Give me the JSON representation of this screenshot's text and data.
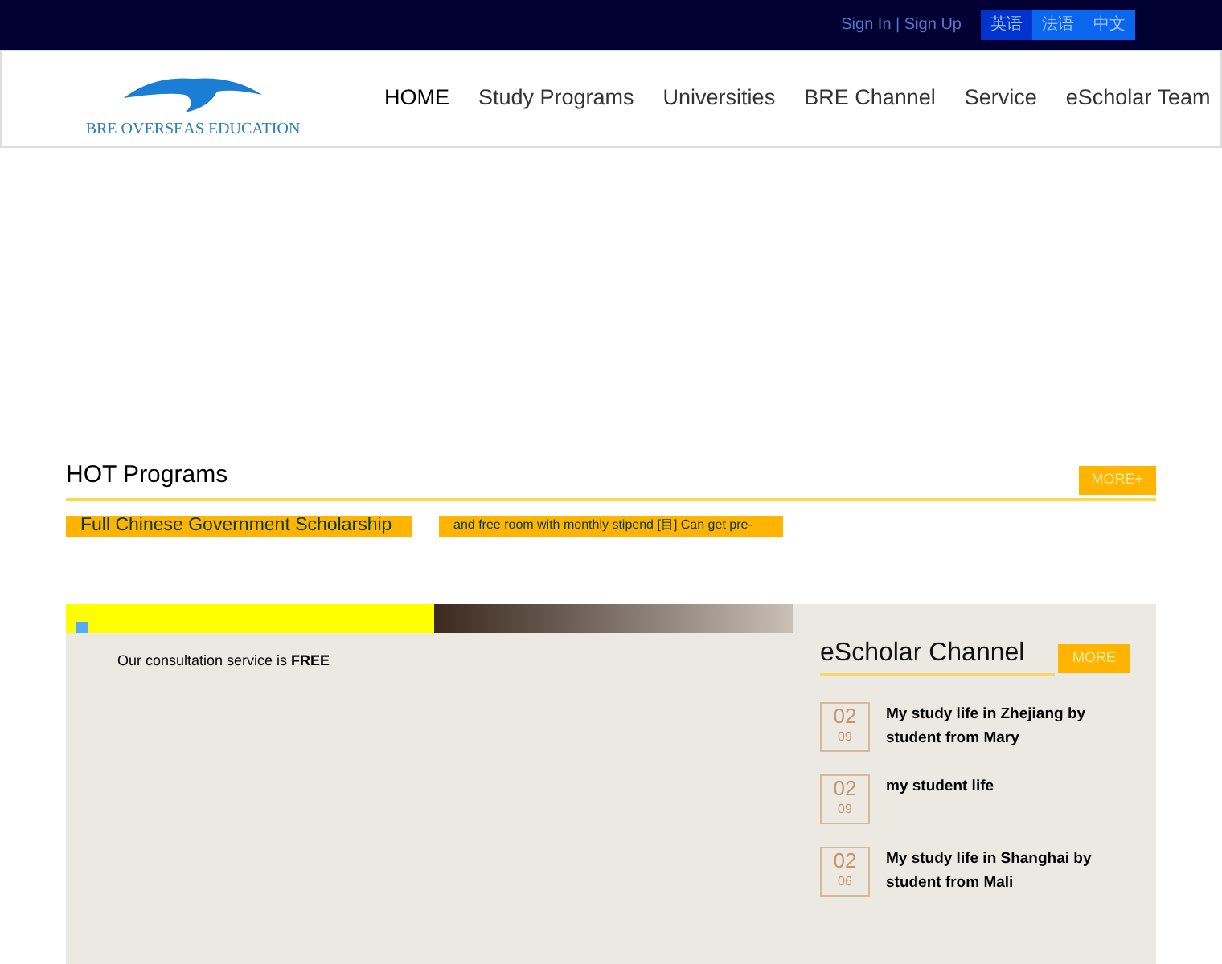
{
  "top_bar": {
    "auth": "Sign In | Sign Up",
    "languages": [
      {
        "label": "英语",
        "selected": true
      },
      {
        "label": "法语",
        "selected": false
      },
      {
        "label": "中文",
        "selected": false
      }
    ]
  },
  "header": {
    "logo_text": "BRE OVERSEAS EDUCATION",
    "nav": [
      {
        "label": "HOME",
        "selected": true
      },
      {
        "label": "Study Programs",
        "selected": false
      },
      {
        "label": "Universities",
        "selected": false
      },
      {
        "label": "BRE Channel",
        "selected": false
      },
      {
        "label": "Service",
        "selected": false
      },
      {
        "label": "eScholar Team",
        "selected": false
      }
    ]
  },
  "hot_programs": {
    "title": "HOT Programs",
    "more": "MORE+",
    "items": [
      "Full Chinese Government Scholarship",
      "and free room with monthly stipend [目] Can get pre-"
    ]
  },
  "banner": {
    "text": "Our consultation service is **FREE**"
  },
  "channel": {
    "title": "eScholar Channel",
    "more": "MORE",
    "posts": [
      {
        "day": "02",
        "month": "09",
        "title": "My study life in Zhejiang by student from Mary"
      },
      {
        "day": "02",
        "month": "09",
        "title": "my student life"
      },
      {
        "day": "02",
        "month": "06",
        "title": "My study life in Shanghai by student from Mali"
      }
    ]
  }
}
